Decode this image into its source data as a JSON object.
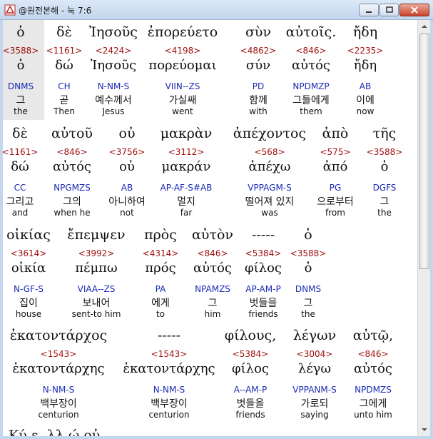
{
  "window": {
    "title": "@원전본해 - 눅 7:6"
  },
  "verse": {
    "line1": {
      "greek": [
        "ὁ",
        "δὲ",
        "Ἰησοῦς",
        "ἐπορεύετο",
        "σὺν",
        "αὐτοῖς.",
        "ἤδη"
      ],
      "strong": [
        "<3588>",
        "<1161>",
        "<2424>",
        "<4198>",
        "<4862>",
        "<846>",
        "<2235>"
      ],
      "lemma": [
        "ὁ",
        "δώ",
        "Ἰησοῦς",
        "πορεύομαι",
        "σύν",
        "αὐτός",
        "ἤδη"
      ],
      "morph": [
        "DNMS",
        "CH",
        "N-NM-S",
        "VIIN--ZS",
        "PD",
        "NPDMZP",
        "AB"
      ],
      "korean": [
        "그",
        "곧",
        "예수께서",
        "가실쌔",
        "함께",
        "그들에게",
        "이에"
      ],
      "english": [
        "the",
        "Then",
        "Jesus",
        "went",
        "with",
        "them",
        "now"
      ]
    },
    "line2": {
      "greek": [
        "δὲ",
        "αὐτοῦ",
        "οὐ",
        "μακρὰν",
        "ἀπέχοντος",
        "ἀπὸ",
        "τῆς"
      ],
      "strong": [
        "<1161>",
        "<846>",
        "<3756>",
        "<3112>",
        "<568>",
        "<575>",
        "<3588>"
      ],
      "lemma": [
        "δώ",
        "αὐτός",
        "οὐ",
        "μακράν",
        "ἀπέχω",
        "ἀπό",
        "ὁ"
      ],
      "morph": [
        "CC",
        "NPGMZS",
        "AB",
        "AP-AF-S#AB",
        "VPPAGM-S",
        "PG",
        "DGFS"
      ],
      "korean": [
        "그리고",
        "그의",
        "아니하여",
        "멀지",
        "떨어져 있지",
        "으로부터",
        "그"
      ],
      "english": [
        "and",
        "when he",
        "not",
        "far",
        "was",
        "from",
        "the"
      ]
    },
    "line3": {
      "greek": [
        "οἰκίας",
        "ἔπεμψεν",
        "πρὸς",
        "αὐτὸν",
        "-----",
        "ὁ"
      ],
      "strong": [
        "<3614>",
        "<3992>",
        "<4314>",
        "<846>",
        "<5384>",
        "<3588>"
      ],
      "lemma": [
        "οἰκία",
        "πέμπω",
        "πρός",
        "αὐτός",
        "φίλος",
        "ὁ"
      ],
      "morph": [
        "N-GF-S",
        "VIAA--ZS",
        "PA",
        "NPAMZS",
        "AP-AM-P",
        "DNMS"
      ],
      "korean": [
        "집이",
        "보내어",
        "에게",
        "그",
        "벗들을",
        "그"
      ],
      "english": [
        "house",
        "sent-to him",
        "to",
        "him",
        "friends",
        "the"
      ]
    },
    "line4": {
      "greek": [
        "ἑκατοντάρχος",
        "-----",
        "φίλους,",
        "λέγων",
        "αὐτῷ,"
      ],
      "strong": [
        "<1543>",
        "<1543>",
        "<5384>",
        "<3004>",
        "<846>"
      ],
      "lemma": [
        "ἑκατοντάρχης",
        "ἑκατοντάρχης",
        "φίλος",
        "λέγω",
        "αὐτός"
      ],
      "morph": [
        "N-NM-S",
        "N-NM-S",
        "A--AM-P",
        "VPPANM-S",
        "NPDMZS"
      ],
      "korean": [
        "백부장이",
        "백부장이",
        "벗들을",
        "가로되",
        "그에게"
      ],
      "english": [
        "centurion",
        "centurion",
        "friends",
        "saying",
        "unto him"
      ]
    },
    "partial_next_line": "Κύ   ε,        λλ           ώ        οὐ"
  },
  "colors": {
    "strong": "#a01010",
    "morph": "#1a2ab5",
    "text": "#111111",
    "titlebar": "#c3d6ee"
  }
}
